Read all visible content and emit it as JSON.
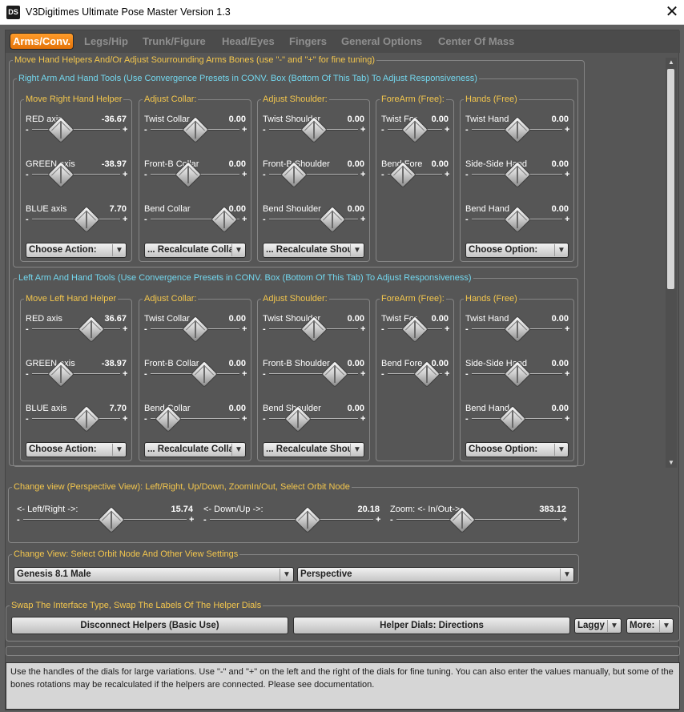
{
  "window": {
    "icon_text": "DS",
    "title": "V3Digitimes Ultimate Pose Master Version 1.3",
    "close_glyph": "✕"
  },
  "tabs": [
    {
      "label": "Arms/Conv.",
      "active": true
    },
    {
      "label": "Legs/Hip"
    },
    {
      "label": "Trunk/Figure"
    },
    {
      "label": "Head/Eyes"
    },
    {
      "label": "Fingers"
    },
    {
      "label": "General Options"
    },
    {
      "label": "Center Of Mass"
    }
  ],
  "arms": {
    "outer_legend": "Move Hand Helpers And/Or Adjust Sourrounding Arms Bones (use \"-\" and \"+\" for fine tuning)",
    "right": {
      "legend": "Right Arm And Hand Tools (Use Convergence Presets in CONV. Box (Bottom Of This Tab) To Adjust Responsiveness)",
      "helper": {
        "legend": "Move Right Hand Helper",
        "dials": [
          {
            "label": "RED axis",
            "value": "-36.67",
            "pos": 0.33
          },
          {
            "label": "GREEN axis",
            "value": "-38.97",
            "pos": 0.33
          },
          {
            "label": "BLUE axis",
            "value": "7.70",
            "pos": 0.62
          }
        ],
        "combo": "Choose Action:"
      },
      "collar": {
        "legend": "Adjust Collar:",
        "dials": [
          {
            "label": "Twist Collar",
            "value": "0.00",
            "pos": 0.5
          },
          {
            "label": "Front-B Collar",
            "value": "0.00",
            "pos": 0.42
          },
          {
            "label": "Bend Collar",
            "value": "0.00",
            "pos": 0.83
          }
        ],
        "combo": "... Recalculate Colla"
      },
      "shoulder": {
        "legend": "Adjust Shoulder:",
        "dials": [
          {
            "label": "Twist Shoulder",
            "value": "0.00",
            "pos": 0.5
          },
          {
            "label": "Front-B Shoulder",
            "value": "0.00",
            "pos": 0.28
          },
          {
            "label": "Bend Shoulder",
            "value": "0.00",
            "pos": 0.71
          }
        ],
        "combo": "... Recalculate Shoul"
      },
      "forearm": {
        "legend": "ForeArm (Free):",
        "dials": [
          {
            "label": "Twist For",
            "value": "0.00",
            "pos": 0.5
          },
          {
            "label": "Bend Fore",
            "value": "0.00",
            "pos": 0.28
          }
        ]
      },
      "hands": {
        "legend": "Hands (Free)",
        "dials": [
          {
            "label": "Twist Hand",
            "value": "0.00",
            "pos": 0.5
          },
          {
            "label": "Side-Side Hand",
            "value": "0.00",
            "pos": 0.5
          },
          {
            "label": "Bend Hand",
            "value": "0.00",
            "pos": 0.5
          }
        ],
        "combo": "Choose Option:"
      }
    },
    "left": {
      "legend": "Left Arm And Hand Tools (Use Convergence Presets in CONV. Box (Bottom Of This Tab) To Adjust Responsiveness)",
      "helper": {
        "legend": "Move Left Hand Helper",
        "dials": [
          {
            "label": "RED axis",
            "value": "36.67",
            "pos": 0.67
          },
          {
            "label": "GREEN axis",
            "value": "-38.97",
            "pos": 0.33
          },
          {
            "label": "BLUE axis",
            "value": "7.70",
            "pos": 0.62
          }
        ],
        "combo": "Choose Action:"
      },
      "collar": {
        "legend": "Adjust Collar:",
        "dials": [
          {
            "label": "Twist Collar",
            "value": "0.00",
            "pos": 0.5
          },
          {
            "label": "Front-B Collar",
            "value": "0.00",
            "pos": 0.6
          },
          {
            "label": "Bend Collar",
            "value": "0.00",
            "pos": 0.2
          }
        ],
        "combo": "... Recalculate Colla"
      },
      "shoulder": {
        "legend": "Adjust Shoulder:",
        "dials": [
          {
            "label": "Twist Shoulder",
            "value": "0.00",
            "pos": 0.5
          },
          {
            "label": "Front-B Shoulder",
            "value": "0.00",
            "pos": 0.74
          },
          {
            "label": "Bend Shoulder",
            "value": "0.00",
            "pos": 0.32
          }
        ],
        "combo": "... Recalculate Shoul"
      },
      "forearm": {
        "legend": "ForeArm (Free):",
        "dials": [
          {
            "label": "Twist For",
            "value": "0.00",
            "pos": 0.5
          },
          {
            "label": "Bend Fore",
            "value": "0.00",
            "pos": 0.72
          }
        ]
      },
      "hands": {
        "legend": "Hands (Free)",
        "dials": [
          {
            "label": "Twist Hand",
            "value": "0.00",
            "pos": 0.5
          },
          {
            "label": "Side-Side Hand",
            "value": "0.00",
            "pos": 0.5
          },
          {
            "label": "Bend Hand",
            "value": "0.00",
            "pos": 0.45
          }
        ],
        "combo": "Choose Option:"
      }
    }
  },
  "view": {
    "legend": "Change view (Perspective View): Left/Right, Up/Down, ZoomIn/Out, Select Orbit Node",
    "dials": [
      {
        "label": "<- Left/Right ->:",
        "value": "15.74",
        "pos": 0.54
      },
      {
        "label": "<- Down/Up ->:",
        "value": "20.18",
        "pos": 0.6
      },
      {
        "label": "Zoom: <- In/Out->",
        "value": "383.12",
        "pos": 0.4
      }
    ]
  },
  "orbit": {
    "legend": "Change View: Select Orbit Node And Other View Settings",
    "node": "Genesis 8.1 Male",
    "camera": "Perspective"
  },
  "swap": {
    "legend": "Swap The Interface Type, Swap The Labels Of The Helper Dials",
    "disconnect": "Disconnect Helpers (Basic Use)",
    "dials_label": "Helper Dials: Directions",
    "laggy": "Laggy",
    "more": "More:"
  },
  "status": "Use the handles of the dials for large variations. Use \"-\" and \"+\" on the left and the right of the dials for fine tuning. You can also enter the values manually, but some of the bones rotations may be recalculated if the helpers are connected. Please see documentation.",
  "glyphs": {
    "minus": "-",
    "plus": "+",
    "arrow": "▼",
    "up": "▲",
    "down": "▼"
  }
}
